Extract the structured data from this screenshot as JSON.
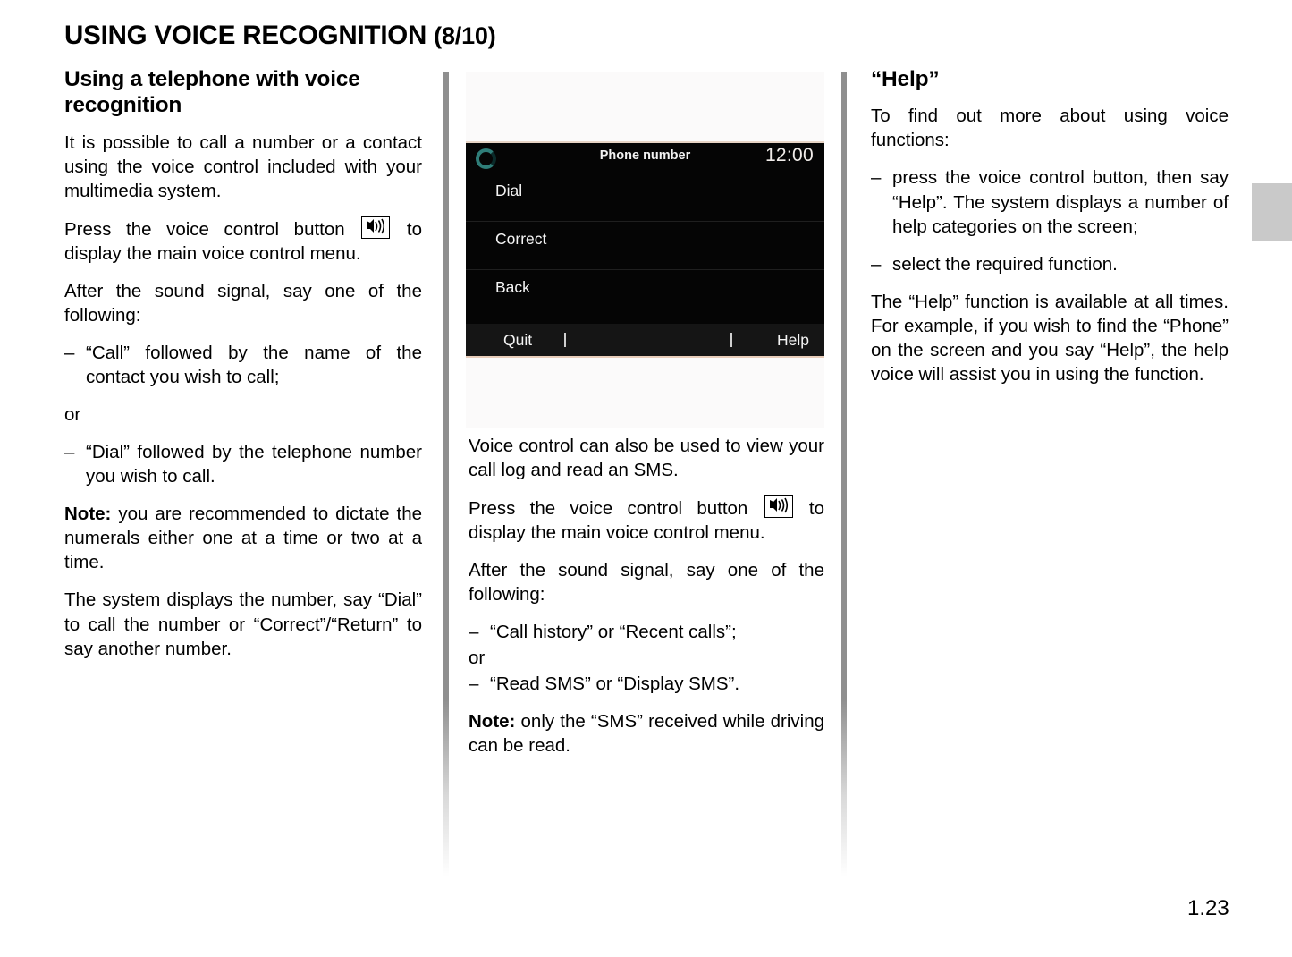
{
  "page": {
    "title_main": "USING VOICE RECOGNITION",
    "title_fraction": "(8/10)",
    "number": "1.23"
  },
  "left_column": {
    "heading": "Using a telephone with voice recognition",
    "p1": "It is possible to call a number or a contact using the voice control included with your multimedia system.",
    "p2_before": "Press the voice control button",
    "p2_after": "to display the main voice control menu.",
    "p3": "After the sound signal, say one of the following:",
    "bullet1_dash": "–",
    "bullet1": "“Call” followed by the name of the contact you wish to call;",
    "or": "or",
    "bullet2_dash": "–",
    "bullet2": "“Dial” followed by the telephone number you wish to call.",
    "note_label": "Note:",
    "note_text": " you are recommended to dictate the numerals either one at a time or two at a time.",
    "p4": "The system displays the number, say “Dial” to call the number or “Correct”/“Return” to say another number."
  },
  "device_screen": {
    "header_title": "Phone number",
    "clock": "12:00",
    "voice_indicator": "voice-ring-icon",
    "menu_items": [
      "Dial",
      "Correct",
      "Back"
    ],
    "footer_left": "Quit",
    "footer_right": "Help",
    "colors": {
      "screen_bg": "#050505",
      "footer_bg": "#151515",
      "ring_accent": "#2f7d78",
      "text": "#f4f4f4"
    }
  },
  "center_column": {
    "p1": "Voice control can also be used to view your call log and read an SMS.",
    "p2_before": "Press the voice control button",
    "p2_after": "to display the main voice control menu.",
    "p3": "After the sound signal, say one of the following:",
    "bullet1_dash": "–",
    "bullet1": "“Call history” or “Recent calls”;",
    "or": "or",
    "bullet2_dash": "–",
    "bullet2": "“Read SMS” or “Display SMS”.",
    "note_label": "Note:",
    "note_text": " only the “SMS” received while driving can be read."
  },
  "right_column": {
    "heading": "“Help”",
    "p1": "To find out more about using voice functions:",
    "bullet1_dash": "–",
    "bullet1": "press the voice control button, then say “Help”. The system displays a number of help categories on the screen;",
    "bullet2_dash": "–",
    "bullet2": "select the required function.",
    "p2": "The “Help” function is available at all times. For example, if you wish to find the “Phone” on the screen and you say “Help”, the help voice will assist you in using the function."
  }
}
